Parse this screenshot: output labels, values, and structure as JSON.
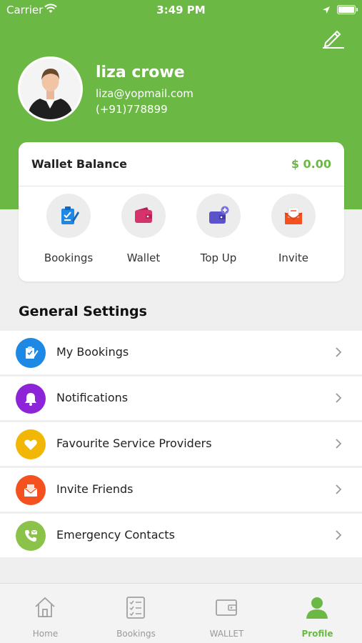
{
  "status_bar": {
    "carrier": "Carrier",
    "time": "3:49 PM"
  },
  "profile": {
    "name": "liza crowe",
    "email": "liza@yopmail.com",
    "phone": "(+91)778899"
  },
  "wallet": {
    "label": "Wallet Balance",
    "amount": "$ 0.00",
    "actions": [
      {
        "label": "Bookings",
        "icon": "clipboard-icon",
        "color": "#1e88e5"
      },
      {
        "label": "Wallet",
        "icon": "wallet-icon",
        "color": "#d6336c"
      },
      {
        "label": "Top Up",
        "icon": "top-up-icon",
        "color": "#5c52c9"
      },
      {
        "label": "Invite",
        "icon": "envelope-icon",
        "color": "#f4511e"
      }
    ]
  },
  "general_settings": {
    "title": "General Settings",
    "items": [
      {
        "label": "My Bookings",
        "icon": "clipboard-icon",
        "color": "#1e88e5"
      },
      {
        "label": "Notifications",
        "icon": "bell-icon",
        "color": "#8e24d8"
      },
      {
        "label": "Favourite Service Providers",
        "icon": "heart-icon",
        "color": "#f2b705"
      },
      {
        "label": "Invite Friends",
        "icon": "envelope-icon",
        "color": "#f4511e"
      },
      {
        "label": "Emergency Contacts",
        "icon": "phone-icon",
        "color": "#8bc34a"
      }
    ]
  },
  "tabbar": {
    "tabs": [
      {
        "label": "Home",
        "icon": "home-icon",
        "active": false
      },
      {
        "label": "Bookings",
        "icon": "checklist-icon",
        "active": false
      },
      {
        "label": "WALLET",
        "icon": "wallet-icon",
        "active": false
      },
      {
        "label": "Profile",
        "icon": "person-icon",
        "active": true
      }
    ]
  },
  "colors": {
    "brand_green": "#6bb944",
    "background": "#efefef"
  }
}
